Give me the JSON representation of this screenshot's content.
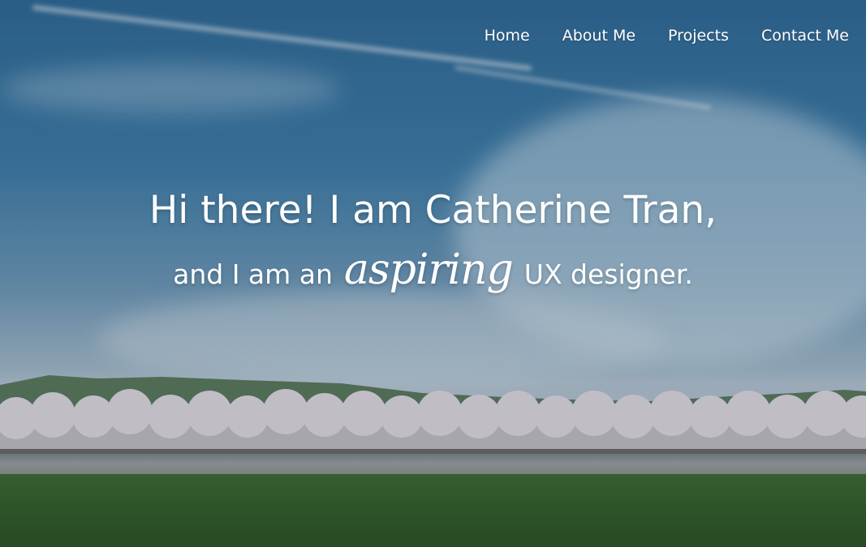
{
  "nav": {
    "items": [
      {
        "label": "Home"
      },
      {
        "label": "About Me"
      },
      {
        "label": "Projects"
      },
      {
        "label": "Contact Me"
      }
    ]
  },
  "hero": {
    "line1": "Hi there! I am Catherine Tran,",
    "line2_before": "and I am an",
    "line2_script": "aspiring",
    "line2_after": "UX designer."
  }
}
